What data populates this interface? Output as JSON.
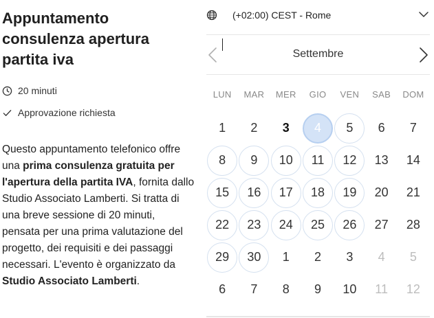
{
  "event": {
    "title": "Appuntamento consulenza apertura partita iva",
    "duration": "20 minuti",
    "approval": "Approvazione richiesta",
    "description": {
      "p1": "Questo appuntamento telefonico offre una ",
      "b1": "prima consulenza gratuita per l'apertura della partita IVA",
      "p2": ", fornita dallo Studio Associato Lamberti. Si tratta di una breve sessione di 20 minuti, pensata per una prima valutazione del progetto, dei requisiti e dei passaggi necessari. L'evento è organizzato da ",
      "b2": "Studio Associato Lamberti",
      "p3": "."
    }
  },
  "timezone": {
    "label": "(+02:00) CEST - Rome",
    "icon": "globe-icon"
  },
  "calendar": {
    "month": "Settembre",
    "weekdays": [
      "LUN",
      "MAR",
      "MER",
      "GIO",
      "VEN",
      "SAB",
      "DOM"
    ],
    "days": [
      {
        "label": "1",
        "state": "plain"
      },
      {
        "label": "2",
        "state": "plain"
      },
      {
        "label": "3",
        "state": "today"
      },
      {
        "label": "4",
        "state": "selected"
      },
      {
        "label": "5",
        "state": "avail"
      },
      {
        "label": "6",
        "state": "plain"
      },
      {
        "label": "7",
        "state": "plain"
      },
      {
        "label": "8",
        "state": "avail"
      },
      {
        "label": "9",
        "state": "avail"
      },
      {
        "label": "10",
        "state": "avail"
      },
      {
        "label": "11",
        "state": "avail"
      },
      {
        "label": "12",
        "state": "avail"
      },
      {
        "label": "13",
        "state": "plain"
      },
      {
        "label": "14",
        "state": "plain"
      },
      {
        "label": "15",
        "state": "avail"
      },
      {
        "label": "16",
        "state": "avail"
      },
      {
        "label": "17",
        "state": "avail"
      },
      {
        "label": "18",
        "state": "avail"
      },
      {
        "label": "19",
        "state": "avail"
      },
      {
        "label": "20",
        "state": "plain"
      },
      {
        "label": "21",
        "state": "plain"
      },
      {
        "label": "22",
        "state": "avail"
      },
      {
        "label": "23",
        "state": "avail"
      },
      {
        "label": "24",
        "state": "avail"
      },
      {
        "label": "25",
        "state": "avail"
      },
      {
        "label": "26",
        "state": "avail"
      },
      {
        "label": "27",
        "state": "plain"
      },
      {
        "label": "28",
        "state": "plain"
      },
      {
        "label": "29",
        "state": "avail"
      },
      {
        "label": "30",
        "state": "avail"
      },
      {
        "label": "1",
        "state": "plain"
      },
      {
        "label": "2",
        "state": "plain"
      },
      {
        "label": "3",
        "state": "plain"
      },
      {
        "label": "4",
        "state": "muted"
      },
      {
        "label": "5",
        "state": "muted"
      },
      {
        "label": "6",
        "state": "plain"
      },
      {
        "label": "7",
        "state": "plain"
      },
      {
        "label": "8",
        "state": "plain"
      },
      {
        "label": "9",
        "state": "plain"
      },
      {
        "label": "10",
        "state": "plain"
      },
      {
        "label": "11",
        "state": "muted"
      },
      {
        "label": "12",
        "state": "muted"
      }
    ]
  },
  "colors": {
    "selected_fill": "#d4e3f7",
    "available_ring": "#d4e0ef",
    "muted_text": "#bdbdbd"
  }
}
